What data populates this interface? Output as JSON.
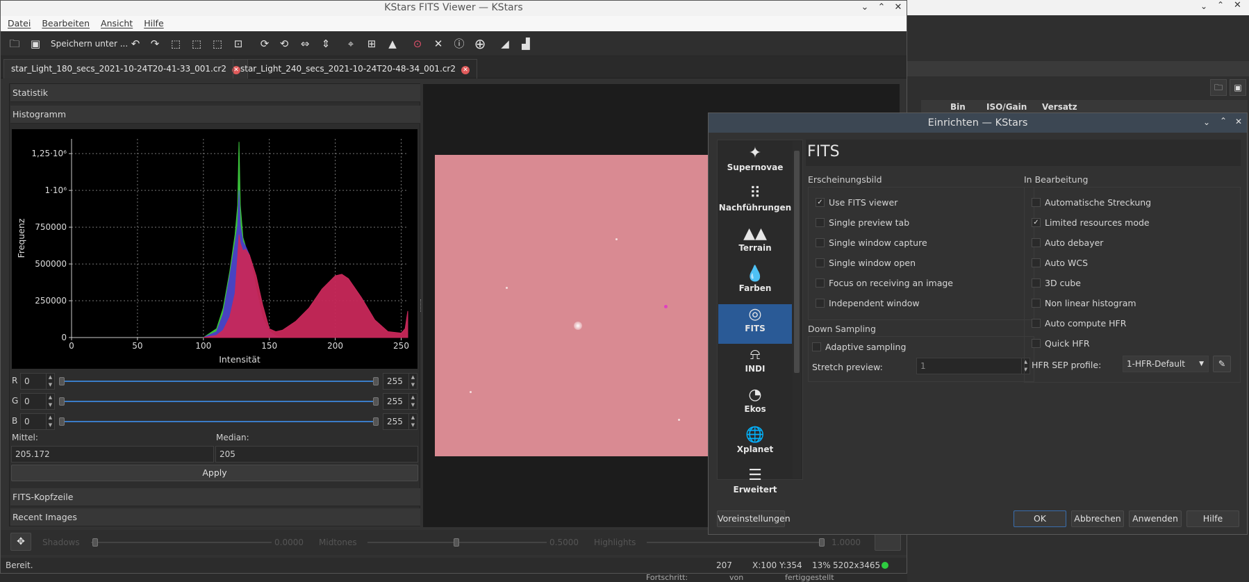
{
  "window": {
    "title": "KStars FITS Viewer — KStars"
  },
  "menu": [
    "Datei",
    "Bearbeiten",
    "Ansicht",
    "Hilfe"
  ],
  "toolbar": {
    "save_as_label": "Speichern unter ..."
  },
  "tabs": [
    {
      "label": "star_Light_180_secs_2021-10-24T20-41-33_001.cr2"
    },
    {
      "label": "star_Light_240_secs_2021-10-24T20-48-34_001.cr2"
    }
  ],
  "panels": {
    "statistics": "Statistik",
    "histogram": "Histogramm",
    "fits_header": "FITS-Kopfzeile",
    "recent_images": "Recent Images"
  },
  "histogram_controls": {
    "channels": [
      {
        "label": "R",
        "min": "0",
        "max": "255"
      },
      {
        "label": "G",
        "min": "0",
        "max": "255"
      },
      {
        "label": "B",
        "min": "0",
        "max": "255"
      }
    ],
    "mean_label": "Mittel:",
    "mean_value": "205.172",
    "median_label": "Median:",
    "median_value": "205",
    "apply_label": "Apply"
  },
  "chart_data": {
    "type": "area",
    "xlabel": "Intensität",
    "ylabel": "Frequenz",
    "xlim": [
      0,
      255
    ],
    "ylim": [
      0,
      1350000
    ],
    "xticks": [
      0,
      50,
      100,
      150,
      200,
      250
    ],
    "ytick_labels": [
      {
        "value": 0,
        "label": "0"
      },
      {
        "value": 250000,
        "label": "250000"
      },
      {
        "value": 500000,
        "label": "500000"
      },
      {
        "value": 750000,
        "label": "750000"
      },
      {
        "value": 1000000,
        "label": "1·10⁶"
      },
      {
        "value": 1250000,
        "label": "1,25·10⁶"
      }
    ],
    "grid": true,
    "series": [
      {
        "color": "#3cc63c",
        "x": [
          100,
          110,
          115,
          120,
          124,
          126,
          127,
          128,
          130,
          132,
          135,
          140,
          145,
          150,
          155,
          160
        ],
        "values": [
          0,
          60000,
          200000,
          450000,
          700000,
          900000,
          1330000,
          900000,
          680000,
          620000,
          520000,
          300000,
          120000,
          40000,
          10000,
          0
        ]
      },
      {
        "color": "#4a3cc8",
        "x": [
          100,
          110,
          115,
          120,
          124,
          126,
          127,
          128,
          130,
          132,
          135,
          140,
          145,
          150,
          155,
          160
        ],
        "values": [
          0,
          40000,
          160000,
          420000,
          640000,
          760000,
          1000000,
          760000,
          650000,
          620000,
          560000,
          330000,
          130000,
          40000,
          10000,
          0
        ]
      },
      {
        "color": "#c8285a",
        "x": [
          100,
          110,
          115,
          120,
          124,
          126,
          127,
          128,
          130,
          132,
          135,
          140,
          145,
          150,
          155,
          160,
          170,
          180,
          190,
          200,
          205,
          210,
          220,
          230,
          240,
          250,
          253,
          255
        ],
        "values": [
          0,
          15000,
          50000,
          140000,
          300000,
          550000,
          700000,
          640000,
          590000,
          600000,
          560000,
          420000,
          220000,
          60000,
          40000,
          50000,
          110000,
          200000,
          330000,
          420000,
          430000,
          400000,
          270000,
          120000,
          40000,
          30000,
          60000,
          180000
        ]
      }
    ]
  },
  "stretch": {
    "shadows_label": "Shadows",
    "shadows_value": "0.0000",
    "midtones_label": "Midtones",
    "midtones_value": "0.5000",
    "highlights_label": "Highlights",
    "highlights_value": "1.0000"
  },
  "statusbar": {
    "ready": "Bereit.",
    "value": "207",
    "coords": "X:100 Y:354",
    "zoom": "13%",
    "size": "5202x3465"
  },
  "background": {
    "col_bin": "Bin",
    "col_iso": "ISO/Gain",
    "col_offset": "Versatz",
    "progress_left": "Fortschritt:",
    "progress_von": "von",
    "progress_done": "fertiggestellt"
  },
  "dialog": {
    "title": "Einrichten — KStars",
    "page_title": "FITS",
    "nav": [
      {
        "label": "Supernovae",
        "icon": "sparkle-icon"
      },
      {
        "label": "Nachführungen",
        "icon": "dots-grid-icon"
      },
      {
        "label": "Terrain",
        "icon": "mountains-icon"
      },
      {
        "label": "Farben",
        "icon": "droplet-icon"
      },
      {
        "label": "FITS",
        "icon": "galaxy-icon"
      },
      {
        "label": "INDI",
        "icon": "telescope-icon"
      },
      {
        "label": "Ekos",
        "icon": "ekos-icon"
      },
      {
        "label": "Xplanet",
        "icon": "globe-icon"
      },
      {
        "label": "Erweitert",
        "icon": "list-icon"
      }
    ],
    "appearance_title": "Erscheinungsbild",
    "appearance": [
      {
        "label": "Use FITS viewer",
        "checked": true
      },
      {
        "label": "Single preview tab",
        "checked": false
      },
      {
        "label": "Single window capture",
        "checked": false
      },
      {
        "label": "Single window open",
        "checked": false
      },
      {
        "label": "Focus on receiving an image",
        "checked": false
      },
      {
        "label": "Independent window",
        "checked": false
      }
    ],
    "processing_title": "In Bearbeitung",
    "processing": [
      {
        "label": "Automatische Streckung",
        "checked": false
      },
      {
        "label": "Limited resources mode",
        "checked": true
      },
      {
        "label": "Auto debayer",
        "checked": false
      },
      {
        "label": "Auto WCS",
        "checked": false
      },
      {
        "label": "3D cube",
        "checked": false
      },
      {
        "label": "Non linear histogram",
        "checked": false
      },
      {
        "label": "Auto compute HFR",
        "checked": false
      },
      {
        "label": "Quick HFR",
        "checked": false
      }
    ],
    "downsampling_title": "Down Sampling",
    "adaptive_label": "Adaptive sampling",
    "stretch_preview_label": "Stretch preview:",
    "stretch_preview_value": "1",
    "hfr_label": "HFR SEP profile:",
    "hfr_value": "1-HFR-Default",
    "defaults_label": "Voreinstellungen",
    "ok_label": "OK",
    "cancel_label": "Abbrechen",
    "apply_label": "Anwenden",
    "help_label": "Hilfe"
  },
  "colors": {
    "accent": "#2a5a96",
    "image": "#d98a92"
  }
}
